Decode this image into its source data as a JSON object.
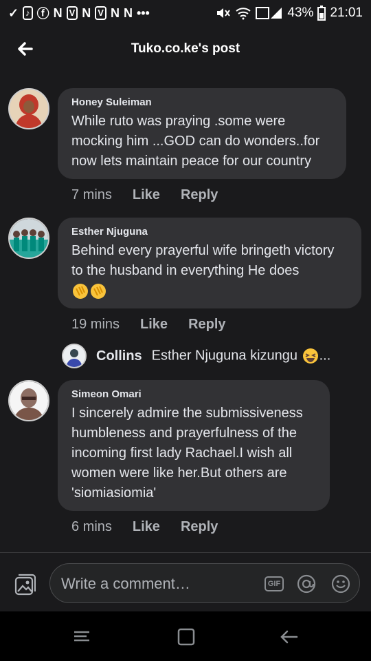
{
  "status_bar": {
    "left_icons": [
      "check-icon",
      "tiktok-icon",
      "facebook-icon",
      "N",
      "V",
      "N",
      "V",
      "N",
      "N",
      "•••"
    ],
    "battery": "43%",
    "time": "21:01"
  },
  "header": {
    "title": "Tuko.co.ke's post"
  },
  "comments": [
    {
      "author": "Honey Suleiman",
      "text": "While ruto was praying .some were mocking him ...GOD can do wonders..for now lets maintain peace for our country",
      "time": "7 mins",
      "like": "Like",
      "reply": "Reply"
    },
    {
      "author": "Esther Njuguna",
      "text": "Behind every prayerful wife bringeth victory to the husband in everything He does",
      "emojis": [
        "clapping-hands",
        "clapping-hands"
      ],
      "time": "19 mins",
      "like": "Like",
      "reply": "Reply",
      "reply_preview": {
        "author": "Collins",
        "text": "Esther Njuguna kizungu",
        "emoji": "laughing-face",
        "ellipsis": "..."
      }
    },
    {
      "author": "Simeon Omari",
      "text": "I sincerely admire the submissiveness humbleness and prayerfulness of the incoming first lady Rachael.I wish all women were like her.But others are 'siomiasiomia'",
      "time": "6 mins",
      "like": "Like",
      "reply": "Reply"
    }
  ],
  "composer": {
    "placeholder": "Write a comment…",
    "gif_label": "GIF"
  },
  "colors": {
    "background": "#1a1a1c",
    "bubble": "#323235",
    "text": "#e4e6eb",
    "secondary": "#b0b3b8"
  }
}
